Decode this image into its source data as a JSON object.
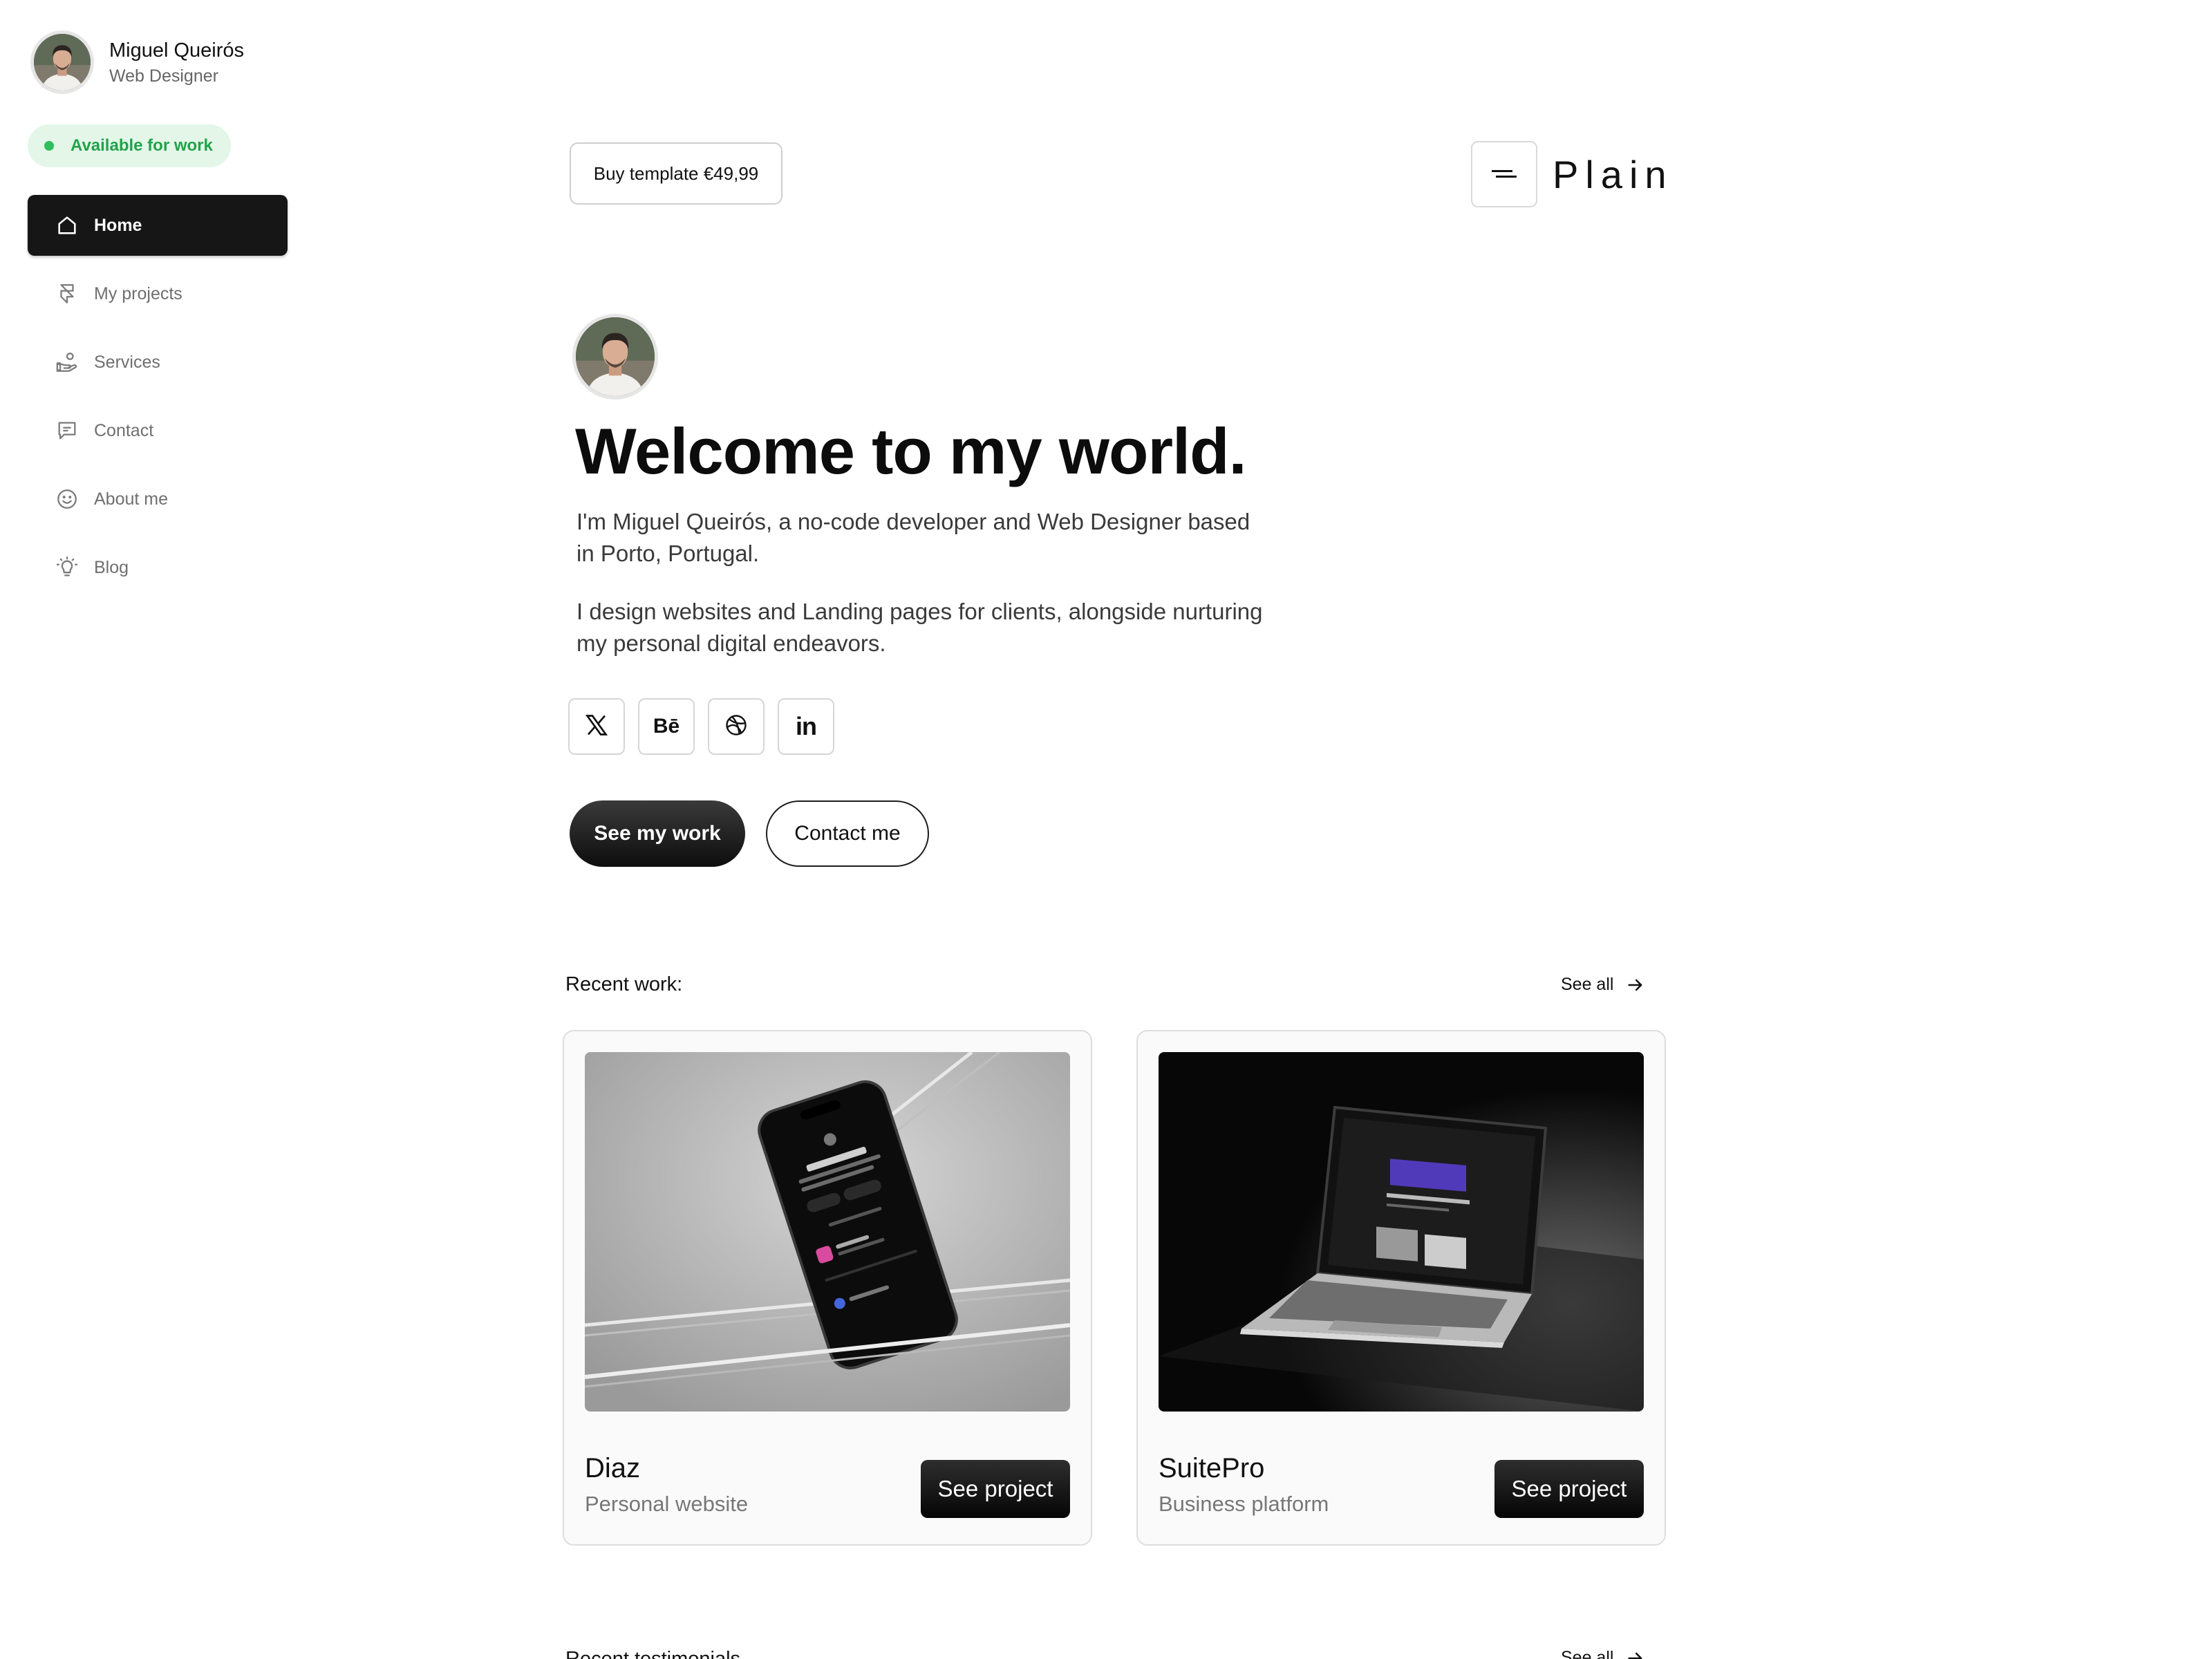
{
  "profile": {
    "name": "Miguel Queirós",
    "role": "Web Designer"
  },
  "availability": {
    "label": "Available for work",
    "color": "#2fbd5a"
  },
  "nav": [
    {
      "label": "Home",
      "icon": "home-icon",
      "active": true
    },
    {
      "label": "My projects",
      "icon": "framer-icon"
    },
    {
      "label": "Services",
      "icon": "hand-coins-icon"
    },
    {
      "label": "Contact",
      "icon": "message-icon"
    },
    {
      "label": "About me",
      "icon": "smile-icon"
    },
    {
      "label": "Blog",
      "icon": "lightbulb-icon"
    }
  ],
  "header": {
    "buy_label": "Buy template €49,99",
    "logo_text": "Plain",
    "logo_icon": "menu-lines-icon"
  },
  "hero": {
    "title": "Welcome to my world.",
    "paragraph1": "I'm Miguel Queirós, a no-code developer and Web Designer based in Porto, Portugal.",
    "paragraph2": "I design websites and Landing pages for clients, alongside nurturing my personal digital endeavors.",
    "socials": [
      {
        "name": "x-icon"
      },
      {
        "name": "behance-icon",
        "glyph": "Bē"
      },
      {
        "name": "dribbble-icon"
      },
      {
        "name": "linkedin-icon",
        "glyph": "in"
      }
    ],
    "primary_cta": "See my work",
    "secondary_cta": "Contact me"
  },
  "recent_work": {
    "label": "Recent work:",
    "see_all": "See all",
    "projects": [
      {
        "title": "Diaz",
        "subtitle": "Personal website",
        "button": "See project",
        "image": "phone-mockup"
      },
      {
        "title": "SuitePro",
        "subtitle": "Business platform",
        "button": "See project",
        "image": "laptop-mockup"
      }
    ]
  },
  "testimonials": {
    "label": "Recent testimonials",
    "see_all": "See all"
  }
}
